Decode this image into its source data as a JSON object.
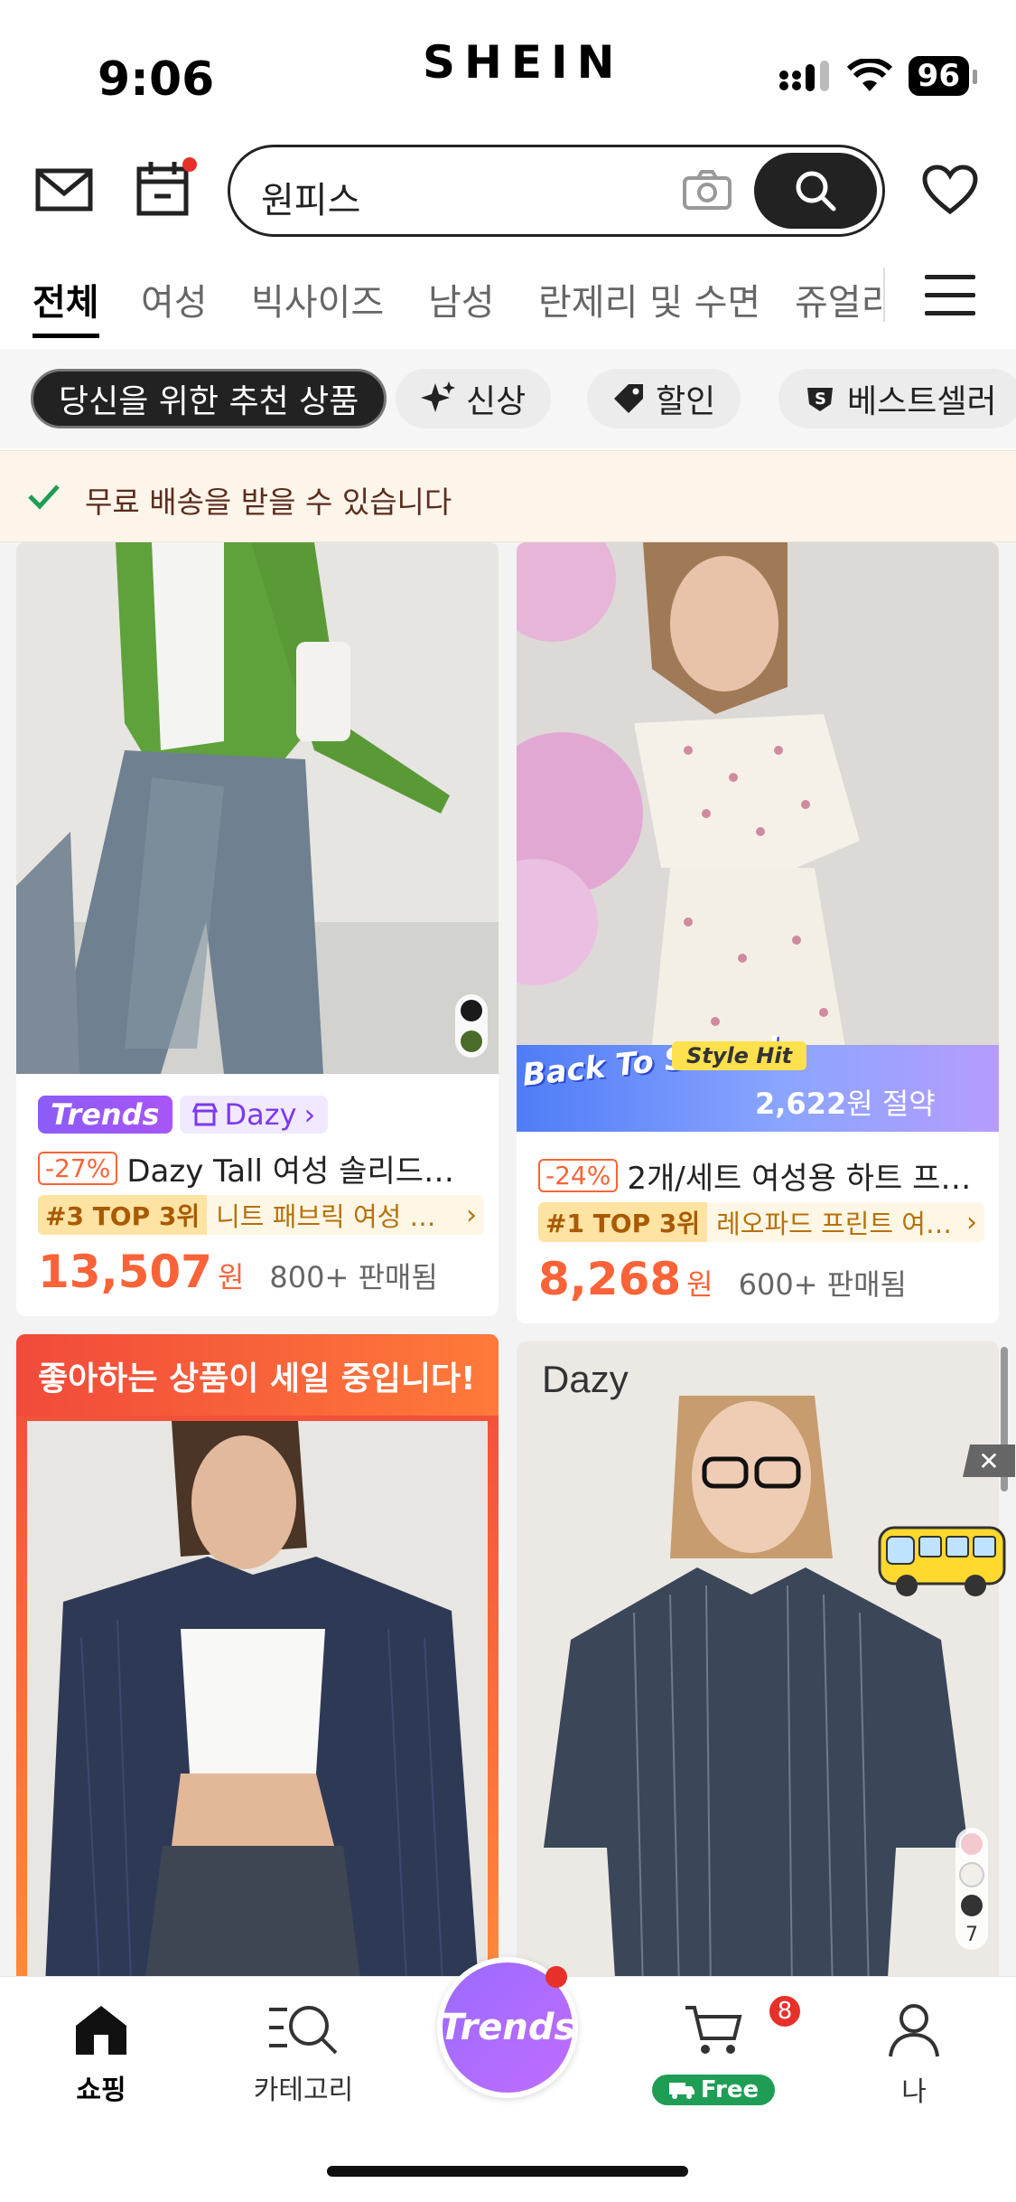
{
  "status_bar": {
    "time": "9:06",
    "brand": "SHEIN",
    "battery": "96"
  },
  "search": {
    "value": "원피스"
  },
  "tabs": [
    {
      "label": "전체",
      "active": true
    },
    {
      "label": "여성"
    },
    {
      "label": "빅사이즈"
    },
    {
      "label": "남성"
    },
    {
      "label": "란제리 및 수면"
    },
    {
      "label": "쥬얼리"
    }
  ],
  "chips": [
    {
      "label": "당신을 위한 추천 상품",
      "active": true
    },
    {
      "label": "신상",
      "icon": "sparkle-icon"
    },
    {
      "label": "할인",
      "icon": "tag-icon"
    },
    {
      "label": "베스트셀러",
      "icon": "bestseller-icon"
    }
  ],
  "shipping": {
    "text": "무료 배송을 받을 수 있습니다"
  },
  "products": [
    {
      "badge": "Trends",
      "store": "Dazy",
      "discount": "-27%",
      "title": "Dazy Tall 여성 솔리드…",
      "rank_label": "#3 TOP 3위",
      "rank_text": "니트 패브릭 여성 경…",
      "price": "13,507",
      "currency": "원",
      "sold": "800+ 판매됨",
      "swatches": [
        "#1a1a1a",
        "#4a6b2a"
      ]
    },
    {
      "promo_title": "Back To School",
      "promo_tag": "Style Hit",
      "promo_amount": "2,622",
      "promo_suffix": "원 절약",
      "discount": "-24%",
      "title": "2개/세트 여성용 하트 프…",
      "rank_label": "#1 TOP 3위",
      "rank_text": "레오파드 프린트 여…",
      "price": "8,268",
      "currency": "원",
      "sold": "600+ 판매됨"
    },
    {
      "sale_header": "좋아하는 상품이 세일 중입니다!"
    },
    {
      "watermark": "Dazy",
      "swatch_count": "7",
      "swatches": [
        "#f2c9cf",
        "#f1efe9",
        "#333333"
      ]
    }
  ],
  "bottom_nav": [
    {
      "label": "쇼핑",
      "active": true
    },
    {
      "label": "카테고리"
    },
    {
      "label": "Trends"
    },
    {
      "label": "Free",
      "badge": "8"
    },
    {
      "label": "나"
    }
  ],
  "colors": {
    "accent": "#fa6338",
    "trends": "#8b5cf6",
    "free": "#1f9d55"
  }
}
